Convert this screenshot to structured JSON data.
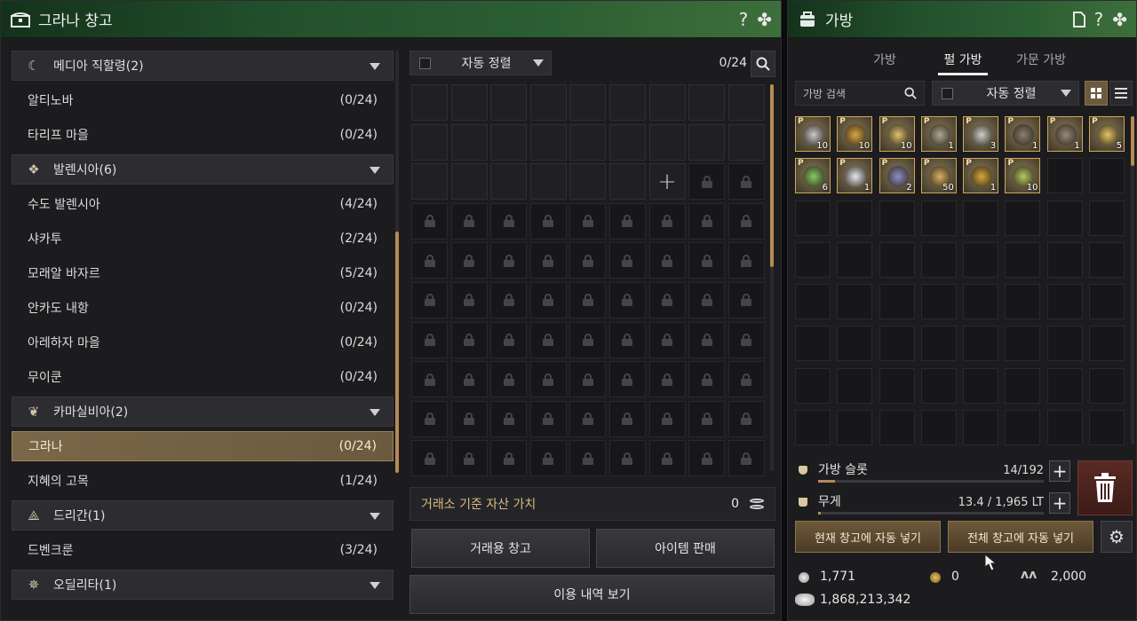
{
  "warehouse": {
    "title": "그라나 창고",
    "help": "?",
    "clover": "✤",
    "groups": [
      {
        "name": "메디아 직할령(2)",
        "icon": "moon-icon",
        "cities": [
          {
            "name": "알티노바",
            "count": "(0/24)"
          },
          {
            "name": "타리프 마을",
            "count": "(0/24)"
          }
        ]
      },
      {
        "name": "발렌시아(6)",
        "icon": "valencia-emblem-icon",
        "cities": [
          {
            "name": "수도 발렌시아",
            "count": "(4/24)"
          },
          {
            "name": "샤카투",
            "count": "(2/24)"
          },
          {
            "name": "모래알 바자르",
            "count": "(5/24)"
          },
          {
            "name": "안카도 내항",
            "count": "(0/24)"
          },
          {
            "name": "아레하자 마을",
            "count": "(0/24)"
          },
          {
            "name": "무이쿤",
            "count": "(0/24)"
          }
        ]
      },
      {
        "name": "카마실비아(2)",
        "icon": "kamasylvia-leaf-icon",
        "cities": [
          {
            "name": "그라나",
            "count": "(0/24)",
            "selected": true
          },
          {
            "name": "지혜의 고목",
            "count": "(1/24)"
          }
        ]
      },
      {
        "name": "드리간(1)",
        "icon": "drieghan-emblem-icon",
        "cities": [
          {
            "name": "드벤크룬",
            "count": "(3/24)"
          }
        ]
      },
      {
        "name": "오딜리타(1)",
        "icon": "odyllita-emblem-icon",
        "cities": []
      }
    ],
    "sort_label": "자동 정렬",
    "slot_count": "0/24",
    "value_label": "거래소 기준 자산 가치",
    "value_amount": "0",
    "btn_trade": "거래용 창고",
    "btn_sell": "아이템 판매",
    "btn_history": "이용 내역 보기"
  },
  "bag": {
    "title": "가방",
    "tabs": [
      "가방",
      "펄 가방",
      "가문 가방"
    ],
    "active_tab": 1,
    "search_placeholder": "가방 검색",
    "sort_label": "자동 정렬",
    "items": [
      {
        "name": "scroll-item",
        "qty": "10",
        "color": "#c9c9c9"
      },
      {
        "name": "gold-coin-item",
        "qty": "10",
        "color": "#d9a640"
      },
      {
        "name": "golden-vase-item",
        "qty": "10",
        "color": "#e0c070"
      },
      {
        "name": "mirror-item",
        "qty": "1",
        "color": "#b0a890"
      },
      {
        "name": "feather-item",
        "qty": "3",
        "color": "#cfcfc8"
      },
      {
        "name": "frame-item",
        "qty": "1",
        "color": "#8d7e6e"
      },
      {
        "name": "frame-item-2",
        "qty": "1",
        "color": "#9a8a7a"
      },
      {
        "name": "cards-item",
        "qty": "5",
        "color": "#e4c468"
      },
      {
        "name": "green-potion-item",
        "qty": "6",
        "color": "#8ac860"
      },
      {
        "name": "wing-item",
        "qty": "1",
        "color": "#e8e8f0"
      },
      {
        "name": "crystal-item",
        "qty": "2",
        "color": "#8e8ec0"
      },
      {
        "name": "elixir-item",
        "qty": "50",
        "color": "#d8b060"
      },
      {
        "name": "golden-lamp-item",
        "qty": "1",
        "color": "#d8a838"
      },
      {
        "name": "green-flask-item",
        "qty": "10",
        "color": "#b8c860"
      }
    ],
    "slots_label": "가방 슬롯",
    "slots_value": "14/192",
    "slots_fraction": 0.073,
    "weight_label": "무게",
    "weight_value": "13.4 / 1,965 LT",
    "weight_fraction": 0.007,
    "btn_auto_current": "현재 창고에 자동 넣기",
    "btn_auto_all": "전체 창고에 자동 넣기",
    "silver_small": "1,771",
    "gold_coin": "0",
    "contribution": "2,000",
    "silver_total": "1,868,213,342"
  }
}
